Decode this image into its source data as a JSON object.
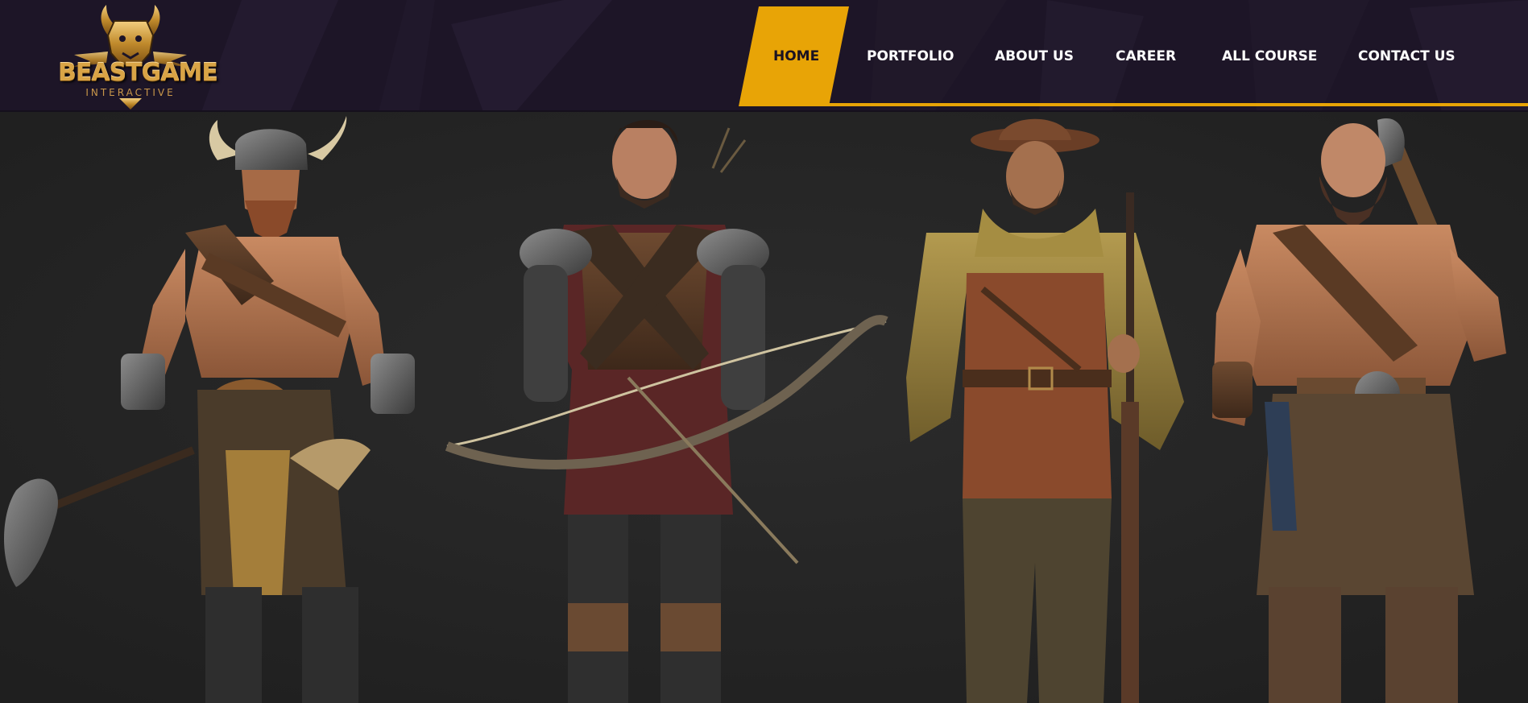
{
  "brand": {
    "name": "BEASTGAME",
    "tagline": "INTERACTIVE"
  },
  "nav": {
    "items": [
      {
        "label": "HOME",
        "active": true
      },
      {
        "label": "PORTFOLIO",
        "active": false
      },
      {
        "label": "ABOUT US",
        "active": false
      },
      {
        "label": "CAREER",
        "active": false
      },
      {
        "label": "ALL COURSE",
        "active": false
      },
      {
        "label": "CONTACT US",
        "active": false
      }
    ]
  },
  "colors": {
    "header_bg": "#1d1527",
    "accent": "#e8a406",
    "hero_bg": "#262626",
    "nav_text": "#ffffff"
  },
  "hero": {
    "characters": [
      {
        "icon": "viking-warrior-figure"
      },
      {
        "icon": "archer-figure"
      },
      {
        "icon": "cowboy-rifleman-figure"
      },
      {
        "icon": "dwarf-axeman-figure"
      }
    ]
  }
}
